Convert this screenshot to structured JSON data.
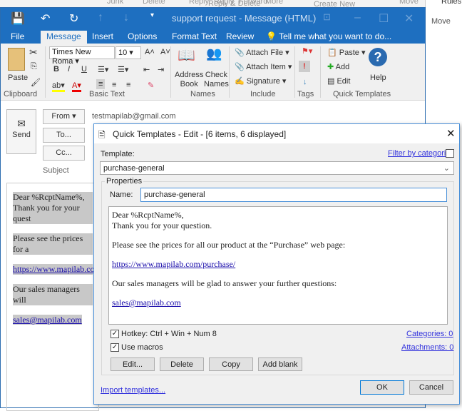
{
  "background": {
    "items": [
      "Junk",
      "Delete",
      "Reply",
      "Reply",
      "Forward",
      "More",
      "Reply & Delete",
      "Create New",
      "Move",
      "Rules",
      "Move"
    ]
  },
  "window": {
    "title": "support request - Message (HTML)"
  },
  "tabs": [
    "File",
    "Message",
    "Insert",
    "Options",
    "Format Text",
    "Review"
  ],
  "tell_me": "Tell me what you want to do...",
  "ribbon": {
    "paste": "Paste",
    "font": "Times New Roma",
    "size": "10",
    "address_book": [
      "Address",
      "Book"
    ],
    "check_names": [
      "Check",
      "Names"
    ],
    "attach_file": "Attach File",
    "attach_item": "Attach Item",
    "signature": "Signature",
    "qt_paste": "Paste",
    "qt_add": "Add",
    "qt_edit": "Edit",
    "help": "Help",
    "groups": [
      "Clipboard",
      "Basic Text",
      "Names",
      "Include",
      "Tags",
      "Quick Templates"
    ]
  },
  "compose": {
    "send": "Send",
    "from": "From",
    "from_value": "testmapilab@gmail.com",
    "to": "To...",
    "cc": "Cc...",
    "subject": "Subject",
    "body": [
      "Dear %RcptName%,",
      "Thank you for your quest",
      "Please see the prices for a",
      "https://www.mapilab.con",
      "Our sales managers will",
      "sales@mapilab.com"
    ]
  },
  "dialog": {
    "title": "Quick Templates - Edit - [6 items, 6 displayed]",
    "template_label": "Template:",
    "filter": "Filter by categories",
    "template_value": "purchase-general",
    "properties": "Properties",
    "name_label": "Name:",
    "name_value": "purchase-general",
    "content": {
      "l1": "Dear %RcptName%,",
      "l2": "Thank you for your question.",
      "l3": "Please see the prices for all our product at the “Purchase” web page:",
      "link": "https://www.mapilab.com/purchase/",
      "l4": "Our sales managers will be glad to answer your further questions:",
      "email": "sales@mapilab.com"
    },
    "hotkey": "Hotkey: Ctrl + Win + Num 8",
    "use_macros": "Use macros",
    "categories": "Categories: 0",
    "attachments": "Attachments: 0",
    "buttons": {
      "edit": "Edit...",
      "delete": "Delete",
      "copy": "Copy",
      "add_blank": "Add blank",
      "ok": "OK",
      "cancel": "Cancel"
    },
    "import": "Import templates..."
  }
}
